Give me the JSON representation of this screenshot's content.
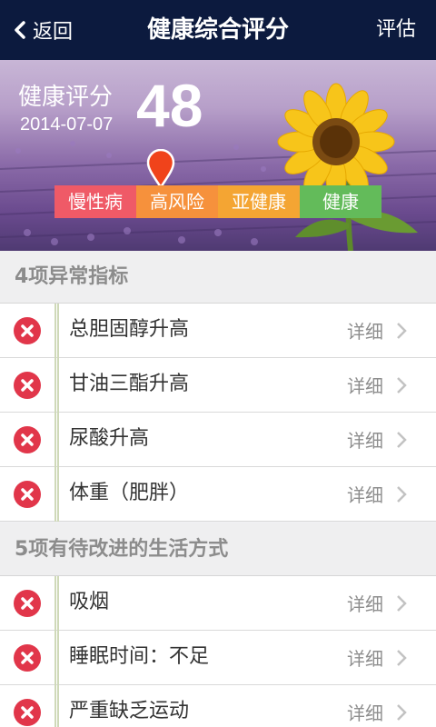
{
  "navbar": {
    "back_label": "返回",
    "title": "健康综合评分",
    "right_label": "评估"
  },
  "hero": {
    "score_label": "健康评分",
    "score_value": "48",
    "date": "2014-07-07",
    "levels": [
      "慢性病",
      "高风险",
      "亚健康",
      "健康"
    ],
    "current_level": "高风险"
  },
  "sections": [
    {
      "title": "4项异常指标",
      "items": [
        {
          "label": "总胆固醇升高",
          "detail": "详细"
        },
        {
          "label": "甘油三酯升高",
          "detail": "详细"
        },
        {
          "label": "尿酸升高",
          "detail": "详细"
        },
        {
          "label": "体重（肥胖）",
          "detail": "详细"
        }
      ]
    },
    {
      "title": "5项有待改进的生活方式",
      "items": [
        {
          "label": "吸烟",
          "detail": "详细"
        },
        {
          "label": "睡眠时间：不足",
          "detail": "详细"
        },
        {
          "label": "严重缺乏运动",
          "detail": "详细"
        }
      ]
    }
  ],
  "colors": {
    "navbar": "#0c1a3e",
    "chronic": "#ef5a67",
    "high_risk": "#f6913c",
    "sub_health": "#f4a533",
    "healthy": "#63bb5a",
    "error_icon": "#e1364a"
  }
}
